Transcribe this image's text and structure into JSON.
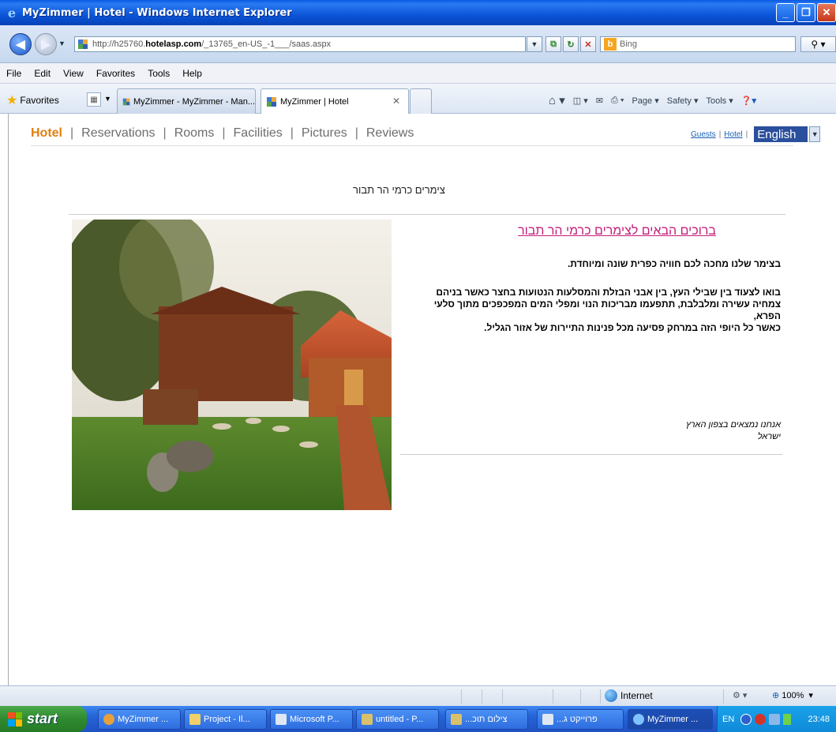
{
  "window": {
    "title": "MyZimmer | Hotel - Windows Internet Explorer"
  },
  "addressbar": {
    "url_prefix": "http://h25760.",
    "url_domain": "hotelasp.com",
    "url_suffix": "/_13765_en-US_-1___/saas.aspx",
    "search_placeholder": "Bing"
  },
  "menubar": {
    "items": [
      "File",
      "Edit",
      "View",
      "Favorites",
      "Tools",
      "Help"
    ]
  },
  "favbar": {
    "favorites_label": "Favorites",
    "tabs": [
      {
        "label": "MyZimmer - MyZimmer - Man..."
      },
      {
        "label": "MyZimmer | Hotel"
      }
    ],
    "commands": {
      "page": "Page ▾",
      "safety": "Safety ▾",
      "tools": "Tools ▾"
    }
  },
  "site": {
    "nav": [
      "Hotel",
      "Reservations",
      "Rooms",
      "Facilities",
      "Pictures",
      "Reviews"
    ],
    "links": {
      "guests": "Guests",
      "hotel": "Hotel"
    },
    "language": "English",
    "site_title": "צימרים כרמי הר תבור",
    "welcome": "ברוכים הבאים לצימרים כרמי הר תבור",
    "desc1": "בצימר שלנו מחכה לכם חוויה כפרית שונה ומיוחדת.",
    "desc2_line1": "בואו לצעוד בין שבילי העץ, בין אבני הבזלת והמסלעות הנטועות בחצר כאשר בניהם",
    "desc2_line2": "צמחיה עשירה ומלבלבת, תתפעמו מבריכות הנוי ומפלי המים המפכפכים מתוך סלעי",
    "desc2_line3": "הפרא,",
    "desc2_line4": "כאשר כל היופי הזה במרחק פסיעה מכל פנינות התיירות של אזור הגליל.",
    "location1": "אנחנו נמצאים בצפון הארץ",
    "location2": "ישראל"
  },
  "statusbar": {
    "zone": "Internet",
    "zoom": "100%"
  },
  "taskbar": {
    "start": "start",
    "tasks": [
      {
        "label": "MyZimmer ..."
      },
      {
        "label": "Project - Il..."
      },
      {
        "label": "Microsoft P..."
      },
      {
        "label": "untitled - P..."
      },
      {
        "label": "...צילום תוכ"
      },
      {
        "label": "...פרוייקט ג"
      },
      {
        "label": "MyZimmer ..."
      }
    ],
    "lang": "EN",
    "clock": "23:48"
  },
  "colors": {
    "nav_active": "#e0810f",
    "welcome_title": "#c41e7a",
    "lang_select": "#2a4f9c"
  }
}
